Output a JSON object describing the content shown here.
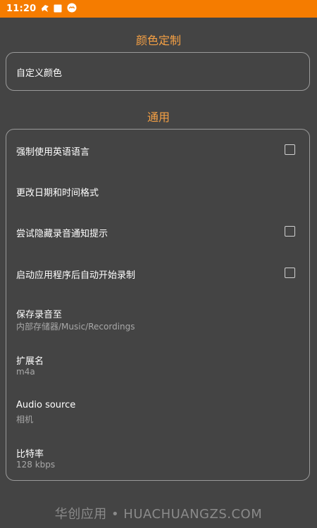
{
  "status_bar": {
    "time": "11:20",
    "icons": [
      "notification-bird-icon",
      "square-icon",
      "cat-icon"
    ],
    "background": "#f57c00"
  },
  "sections": {
    "color": {
      "title": "颜色定制",
      "items": [
        {
          "label": "自定义颜色"
        }
      ]
    },
    "general": {
      "title": "通用",
      "items": [
        {
          "label": "强制使用英语语言",
          "checked": false
        },
        {
          "label": "更改日期和时间格式"
        },
        {
          "label": "尝试隐藏录音通知提示",
          "checked": false
        },
        {
          "label": "启动应用程序后自动开始录制",
          "checked": false
        },
        {
          "label": "保存录音至",
          "value": "内部存储器/Music/Recordings"
        },
        {
          "label": "扩展名",
          "value": "m4a"
        },
        {
          "label": "Audio source",
          "value": "相机"
        },
        {
          "label": "比特率",
          "value": "128 kbps"
        }
      ]
    }
  },
  "watermark": "华创应用 • HUACHUANGZS.COM",
  "colors": {
    "accent": "#f5a044",
    "background": "#444444",
    "border": "#9a9a9a",
    "subtext": "#a8a8a8"
  }
}
